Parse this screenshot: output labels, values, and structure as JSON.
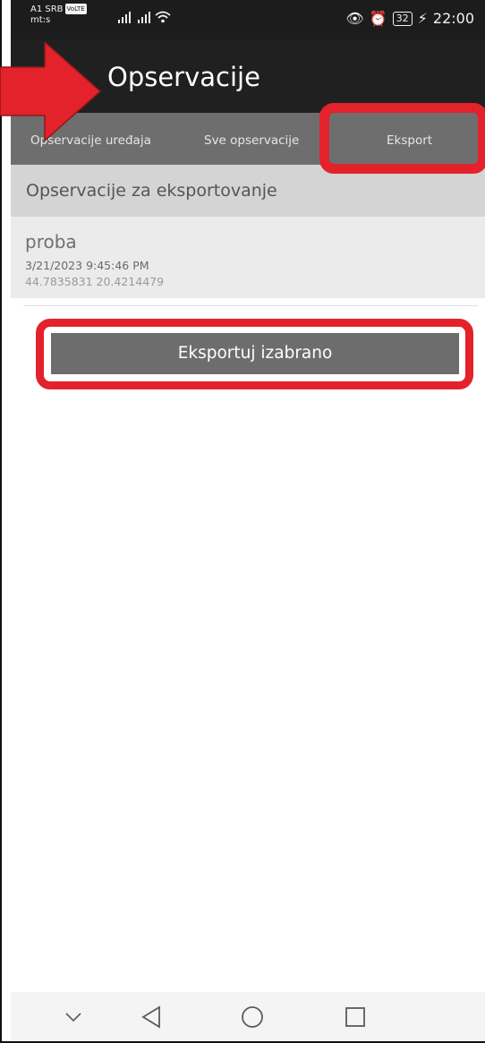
{
  "status_bar": {
    "carrier": "A1 SRB",
    "volte": "VoLTE",
    "carrier2": "mt:s",
    "battery": "32",
    "time": "22:00"
  },
  "app_bar": {
    "title": "Opservacije"
  },
  "tabs": [
    {
      "label": "Opservacije uređaja"
    },
    {
      "label": "Sve opservacije"
    },
    {
      "label": "Eksport"
    }
  ],
  "section": {
    "title": "Opservacije za eksportovanje"
  },
  "observations": [
    {
      "name": "proba",
      "datetime": "3/21/2023 9:45:46 PM",
      "coords": "44.7835831   20.4214479"
    }
  ],
  "export_button": {
    "label": "Eksportuj izabrano"
  },
  "annotation": {
    "color": "#e3222c"
  },
  "icons": {
    "menu": "menu-icon",
    "nav_down": "chevron-down-icon",
    "nav_back": "back-triangle-icon",
    "nav_home": "home-circle-icon",
    "nav_recent": "recent-square-icon"
  }
}
